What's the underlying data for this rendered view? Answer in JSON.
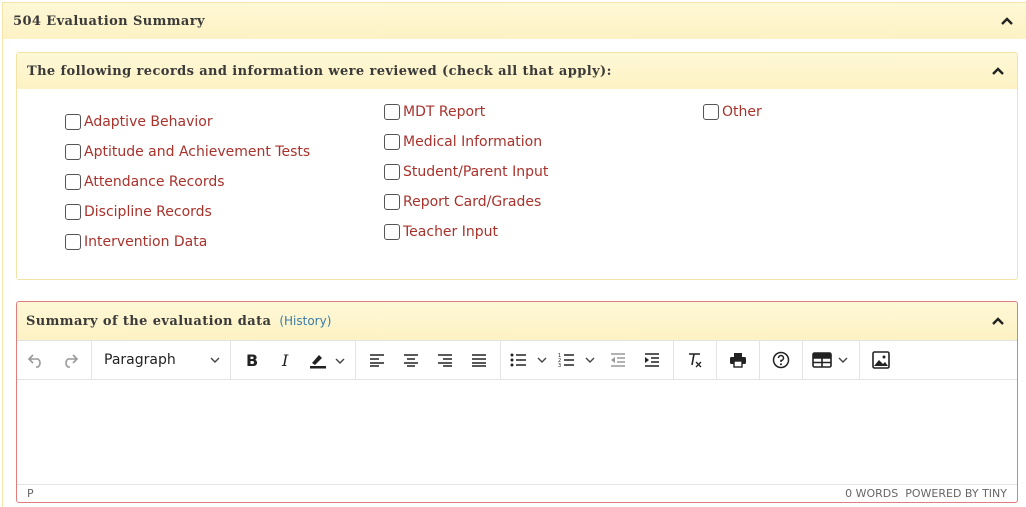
{
  "section": {
    "title": "504 Evaluation Summary"
  },
  "records_panel": {
    "title": "The following records and information were reviewed (check all that apply):",
    "col1": [
      "Adaptive Behavior",
      "Aptitude and Achievement Tests",
      "Attendance Records",
      "Discipline Records",
      "Intervention Data"
    ],
    "col2": [
      "MDT Report",
      "Medical Information",
      "Student/Parent Input",
      "Report Card/Grades",
      "Teacher Input"
    ],
    "col3": [
      "Other"
    ]
  },
  "summary_panel": {
    "title": "Summary of the evaluation data",
    "history_link": "(History)",
    "block_format": "Paragraph",
    "status_path": "P",
    "word_count": "0 WORDS",
    "powered_by": "POWERED BY TINY"
  },
  "colors": {
    "label_red": "#a8322c",
    "header_bg": "#fdf2c4",
    "link_blue": "#3a7ca8",
    "error_border": "#e07e7e"
  },
  "icons": [
    "chevron-up-icon",
    "undo-icon",
    "redo-icon",
    "chevron-down-icon",
    "bold-icon",
    "italic-icon",
    "highlight-icon",
    "align-left-icon",
    "align-center-icon",
    "align-right-icon",
    "align-justify-icon",
    "bullet-list-icon",
    "numbered-list-icon",
    "outdent-icon",
    "indent-icon",
    "clear-format-icon",
    "print-icon",
    "help-icon",
    "table-icon",
    "image-icon"
  ]
}
